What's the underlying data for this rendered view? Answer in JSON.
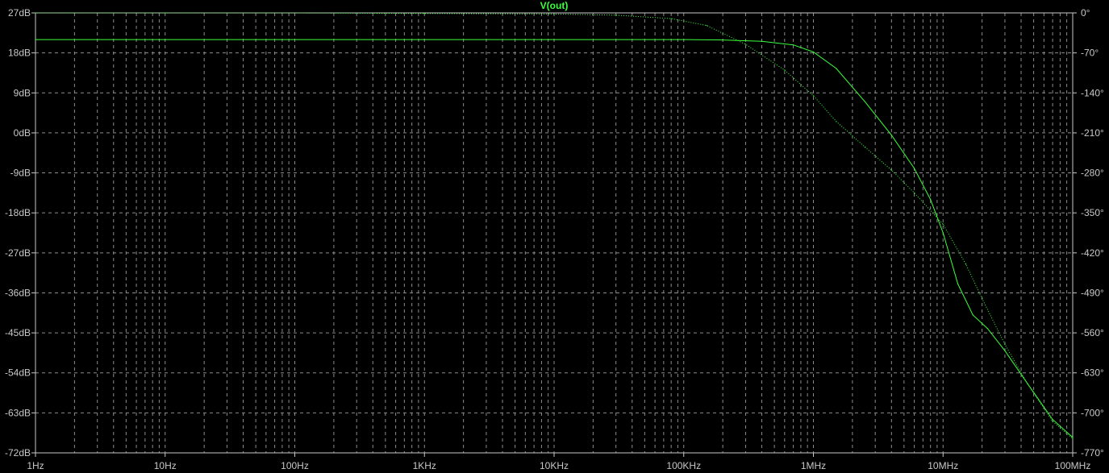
{
  "chart_data": {
    "type": "line",
    "title": "V(out)",
    "x_scale": "log",
    "xlim": [
      1,
      100000000
    ],
    "x_tick_labels": [
      "1Hz",
      "10Hz",
      "100Hz",
      "1KHz",
      "10KHz",
      "100KHz",
      "1MHz",
      "10MHz",
      "100MHz"
    ],
    "y_left_unit": "dB",
    "ylim_left": [
      -72,
      27
    ],
    "y_left_tick_labels": [
      "27dB",
      "18dB",
      "9dB",
      "0dB",
      "-9dB",
      "-18dB",
      "-27dB",
      "-36dB",
      "-45dB",
      "-54dB",
      "-63dB",
      "-72dB"
    ],
    "ylim_right": [
      -770,
      0
    ],
    "y_right_tick_labels": [
      "0°",
      "-70°",
      "-140°",
      "-210°",
      "-280°",
      "-350°",
      "-420°",
      "-490°",
      "-560°",
      "-630°",
      "-700°",
      "-770°"
    ],
    "grid": true,
    "colors": {
      "background": "#000000",
      "trace": "#3cff3c",
      "grid": "#8c8c8c",
      "text": "#c8c8c8"
    },
    "series": [
      {
        "axis": "left",
        "style": "solid",
        "x": [
          1,
          10,
          100,
          1000,
          10000,
          100000,
          200000,
          400000,
          700000,
          1000000,
          1500000,
          2500000,
          4000000,
          6000000,
          8000000,
          10000000,
          13000000,
          17000000,
          22000000,
          30000000,
          45000000,
          70000000,
          100000000
        ],
        "y": [
          21,
          21,
          21,
          21,
          21,
          21,
          20.9,
          20.6,
          19.8,
          18.2,
          14.5,
          7,
          -0.5,
          -8,
          -15,
          -22.5,
          -34,
          -41,
          -44,
          -49,
          -56.5,
          -64.5,
          -68.5
        ]
      },
      {
        "axis": "right",
        "style": "dotted",
        "x": [
          1,
          10,
          100,
          1000,
          10000,
          30000,
          80000,
          150000,
          300000,
          600000,
          1000000,
          1500000,
          2500000,
          4000000,
          6000000,
          10000000,
          15000000,
          20000000,
          30000000,
          45000000,
          70000000,
          100000000
        ],
        "y": [
          0,
          0,
          0,
          -1,
          -2,
          -4,
          -10,
          -22,
          -55,
          -100,
          -145,
          -190,
          -235,
          -275,
          -315,
          -370,
          -440,
          -500,
          -580,
          -650,
          -715,
          -745
        ]
      }
    ]
  }
}
